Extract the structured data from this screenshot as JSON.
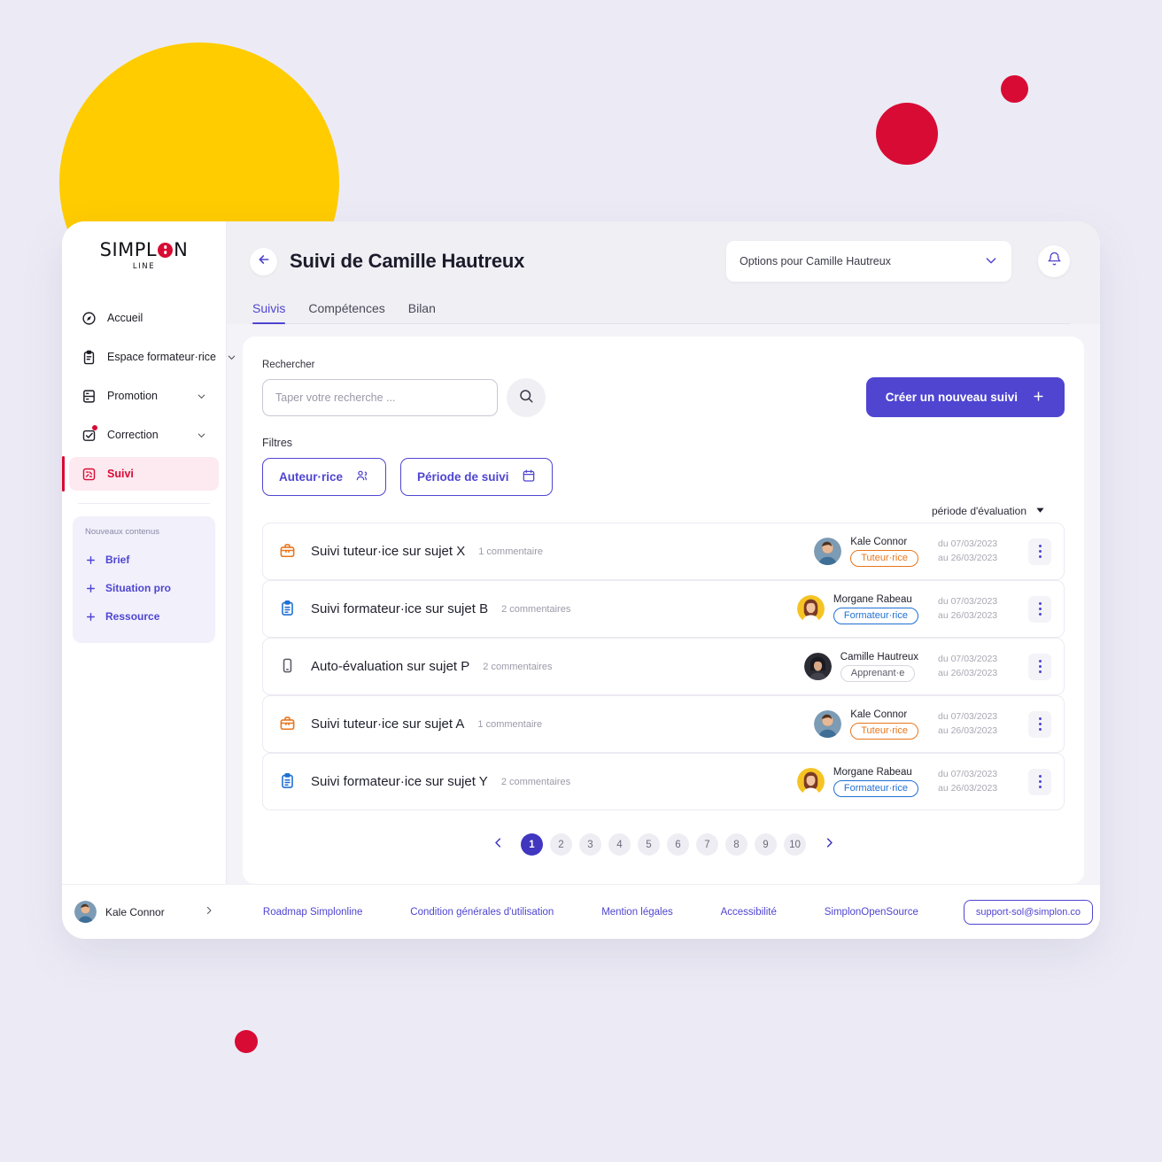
{
  "colors": {
    "brand_red": "#D80B35",
    "brand_yellow": "#FFCC00",
    "accent_purple": "#4F45D1",
    "tuteur_orange": "#E8761C",
    "formateur_blue": "#1F6FD4",
    "page_background": "#ECEBF5"
  },
  "sidebar": {
    "logo": {
      "word": "SIMPL",
      "word_end": "N",
      "sub": "LINE"
    },
    "items": [
      {
        "label": "Accueil",
        "icon": "compass-icon",
        "expandable": false,
        "active": false,
        "badge": false
      },
      {
        "label": "Espace formateur·rice",
        "icon": "clipboard-icon",
        "expandable": true,
        "active": false,
        "badge": false
      },
      {
        "label": "Promotion",
        "icon": "archive-icon",
        "expandable": true,
        "active": false,
        "badge": false
      },
      {
        "label": "Correction",
        "icon": "check-square-icon",
        "expandable": true,
        "active": false,
        "badge": true
      },
      {
        "label": "Suivi",
        "icon": "grid-tracking-icon",
        "expandable": false,
        "active": true,
        "badge": false
      }
    ],
    "new_content": {
      "title": "Nouveaux contenus",
      "items": [
        {
          "label": "Brief",
          "icon": "plus-icon"
        },
        {
          "label": "Situation pro",
          "icon": "plus-icon"
        },
        {
          "label": "Ressource",
          "icon": "plus-icon"
        }
      ]
    }
  },
  "header": {
    "back_icon": "arrow-left-icon",
    "title": "Suivi de Camille Hautreux",
    "options_select": {
      "value": "Options pour Camille Hautreux",
      "chevron_icon": "chevron-down-icon"
    },
    "bell_icon": "bell-icon"
  },
  "tabs": [
    {
      "label": "Suivis",
      "active": true
    },
    {
      "label": "Compétences",
      "active": false
    },
    {
      "label": "Bilan",
      "active": false
    }
  ],
  "search": {
    "label": "Rechercher",
    "placeholder": "Taper votre recherche ...",
    "value": "",
    "button_icon": "search-icon"
  },
  "create_button": {
    "label": "Créer un nouveau suivi",
    "icon": "plus-icon"
  },
  "filters": {
    "label": "Filtres",
    "chips": [
      {
        "label": "Auteur·rice",
        "icon": "users-icon"
      },
      {
        "label": "Période de suivi",
        "icon": "calendar-icon"
      }
    ]
  },
  "sort": {
    "label": "période d'évaluation",
    "icon": "caret-down-icon"
  },
  "list": {
    "rows": [
      {
        "icon": "briefcase-icon",
        "icon_kind": "briefcase",
        "title": "Suivi tuteur·ice sur sujet X",
        "comments": "1 commentaire",
        "author": "Kale Connor",
        "avatar_kind": "kale",
        "role": "Tuteur·rice",
        "role_kind": "tuteur",
        "date_from": "du 07/03/2023",
        "date_to": "au 26/03/2023",
        "menu_icon": "kebab-menu-icon"
      },
      {
        "icon": "clipboard-icon",
        "icon_kind": "clipboard",
        "title": "Suivi formateur·ice sur sujet B",
        "comments": "2 commentaires",
        "author": "Morgane Rabeau",
        "avatar_kind": "morgane",
        "role": "Formateur·rice",
        "role_kind": "formateur",
        "date_from": "du 07/03/2023",
        "date_to": "au 26/03/2023",
        "menu_icon": "kebab-menu-icon"
      },
      {
        "icon": "mobile-icon",
        "icon_kind": "mobile",
        "title": "Auto-évaluation sur sujet P",
        "comments": "2 commentaires",
        "author": "Camille Hautreux",
        "avatar_kind": "camille",
        "role": "Apprenant·e",
        "role_kind": "apprenant",
        "date_from": "du 07/03/2023",
        "date_to": "au 26/03/2023",
        "menu_icon": "kebab-menu-icon"
      },
      {
        "icon": "briefcase-icon",
        "icon_kind": "briefcase",
        "title": "Suivi tuteur·ice sur sujet A",
        "comments": "1 commentaire",
        "author": "Kale Connor",
        "avatar_kind": "kale",
        "role": "Tuteur·rice",
        "role_kind": "tuteur",
        "date_from": "du 07/03/2023",
        "date_to": "au 26/03/2023",
        "menu_icon": "kebab-menu-icon"
      },
      {
        "icon": "clipboard-icon",
        "icon_kind": "clipboard",
        "title": "Suivi formateur·ice sur sujet Y",
        "comments": "2 commentaires",
        "author": "Morgane Rabeau",
        "avatar_kind": "morgane",
        "role": "Formateur·rice",
        "role_kind": "formateur",
        "date_from": "du 07/03/2023",
        "date_to": "au 26/03/2023",
        "menu_icon": "kebab-menu-icon"
      }
    ]
  },
  "pagination": {
    "prev_icon": "chevron-left-icon",
    "next_icon": "chevron-right-icon",
    "pages": [
      "1",
      "2",
      "3",
      "4",
      "5",
      "6",
      "7",
      "8",
      "9",
      "10"
    ],
    "current": "1"
  },
  "footer": {
    "user": {
      "name": "Kale Connor",
      "chevron_icon": "chevron-right-icon",
      "avatar_kind": "kale"
    },
    "links": [
      "Roadmap Simplonline",
      "Condition générales d'utilisation",
      "Mention légales",
      "Accessibilité",
      "SimplonOpenSource"
    ],
    "support": "support-sol@simplon.co"
  }
}
